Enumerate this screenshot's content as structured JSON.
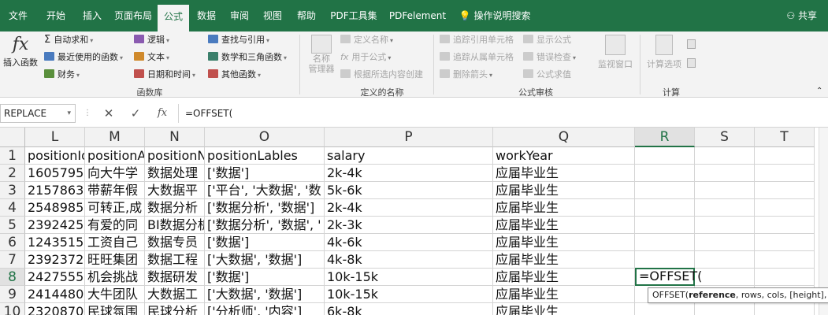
{
  "tabs": [
    "文件",
    "开始",
    "插入",
    "页面布局",
    "公式",
    "数据",
    "审阅",
    "视图",
    "帮助",
    "PDF工具集",
    "PDFelement",
    "操作说明搜索"
  ],
  "active_tab": "公式",
  "share_label": "共享",
  "ribbon": {
    "insert_function": "插入函数",
    "function_library": {
      "autosum": "自动求和",
      "recent": "最近使用的函数",
      "financial": "财务",
      "logical": "逻辑",
      "text": "文本",
      "datetime": "日期和时间",
      "lookup": "查找与引用",
      "math": "数学和三角函数",
      "more": "其他函数",
      "group_label": "函数库"
    },
    "defined_names": {
      "name_manager": "名称\n管理器",
      "define_name": "定义名称",
      "use_in_formula": "用于公式",
      "create_from_selection": "根据所选内容创建",
      "group_label": "定义的名称"
    },
    "formula_auditing": {
      "trace_precedents": "追踪引用单元格",
      "trace_dependents": "追踪从属单元格",
      "remove_arrows": "删除箭头",
      "show_formulas": "显示公式",
      "error_checking": "错误检查",
      "evaluate_formula": "公式求值",
      "watch_window": "监视窗口",
      "group_label": "公式审核"
    },
    "calculation": {
      "calc_options": "计算选项",
      "group_label": "计算"
    }
  },
  "formula_bar": {
    "name_box": "REPLACE",
    "cancel": "✕",
    "enter": "✓",
    "fx": "fx",
    "formula": "=OFFSET("
  },
  "grid": {
    "columns": [
      "L",
      "M",
      "N",
      "O",
      "P",
      "Q",
      "R",
      "S",
      "T"
    ],
    "selected_column": "R",
    "selected_row": "8",
    "rows": [
      {
        "num": "1",
        "cells": [
          "positionId",
          "positionAdvantage",
          "positionName",
          "positionLables",
          "salary",
          "workYear",
          "",
          "",
          ""
        ]
      },
      {
        "num": "2",
        "cells": [
          "1605795",
          "向大牛学",
          "数据处理",
          "['数据']",
          "2k-4k",
          "应届毕业生",
          "",
          "",
          ""
        ]
      },
      {
        "num": "3",
        "cells": [
          "2157863",
          "带薪年假",
          "大数据平",
          "['平台', '大数据', '数",
          "5k-6k",
          "应届毕业生",
          "",
          "",
          ""
        ]
      },
      {
        "num": "4",
        "cells": [
          "2548985",
          "可转正,成",
          "数据分析",
          "['数据分析', '数据']",
          "2k-4k",
          "应届毕业生",
          "",
          "",
          ""
        ]
      },
      {
        "num": "5",
        "cells": [
          "2392425",
          "有爱的同",
          "BI数据分析",
          "['数据分析', '数据', '",
          "2k-3k",
          "应届毕业生",
          "",
          "",
          ""
        ]
      },
      {
        "num": "6",
        "cells": [
          "1243515",
          "工资自己",
          "数据专员",
          "['数据']",
          "4k-6k",
          "应届毕业生",
          "",
          "",
          ""
        ]
      },
      {
        "num": "7",
        "cells": [
          "2392372",
          "旺旺集团",
          "数据工程",
          "['大数据', '数据']",
          "4k-8k",
          "应届毕业生",
          "",
          "",
          ""
        ]
      },
      {
        "num": "8",
        "cells": [
          "2427555",
          "机会挑战",
          "数据研发",
          "['数据']",
          "10k-15k",
          "应届毕业生",
          "=OFFSET(",
          "",
          ""
        ]
      },
      {
        "num": "9",
        "cells": [
          "2414480",
          "大牛团队",
          "大数据工",
          "['大数据', '数据']",
          "10k-15k",
          "应届毕业生",
          "",
          "",
          ""
        ]
      },
      {
        "num": "10",
        "cells": [
          "2320870",
          "民球氛围",
          "民球分析",
          "['分析师', '内容']",
          "6k-8k",
          "应届毕业生",
          "",
          "",
          ""
        ]
      }
    ],
    "tooltip_fn": "OFFSET(",
    "tooltip_bold": "reference",
    "tooltip_rest": ", rows, cols, [height], [wi"
  },
  "colors": {
    "excel_green": "#217346",
    "ribbon_bg": "#f3f3f3"
  }
}
